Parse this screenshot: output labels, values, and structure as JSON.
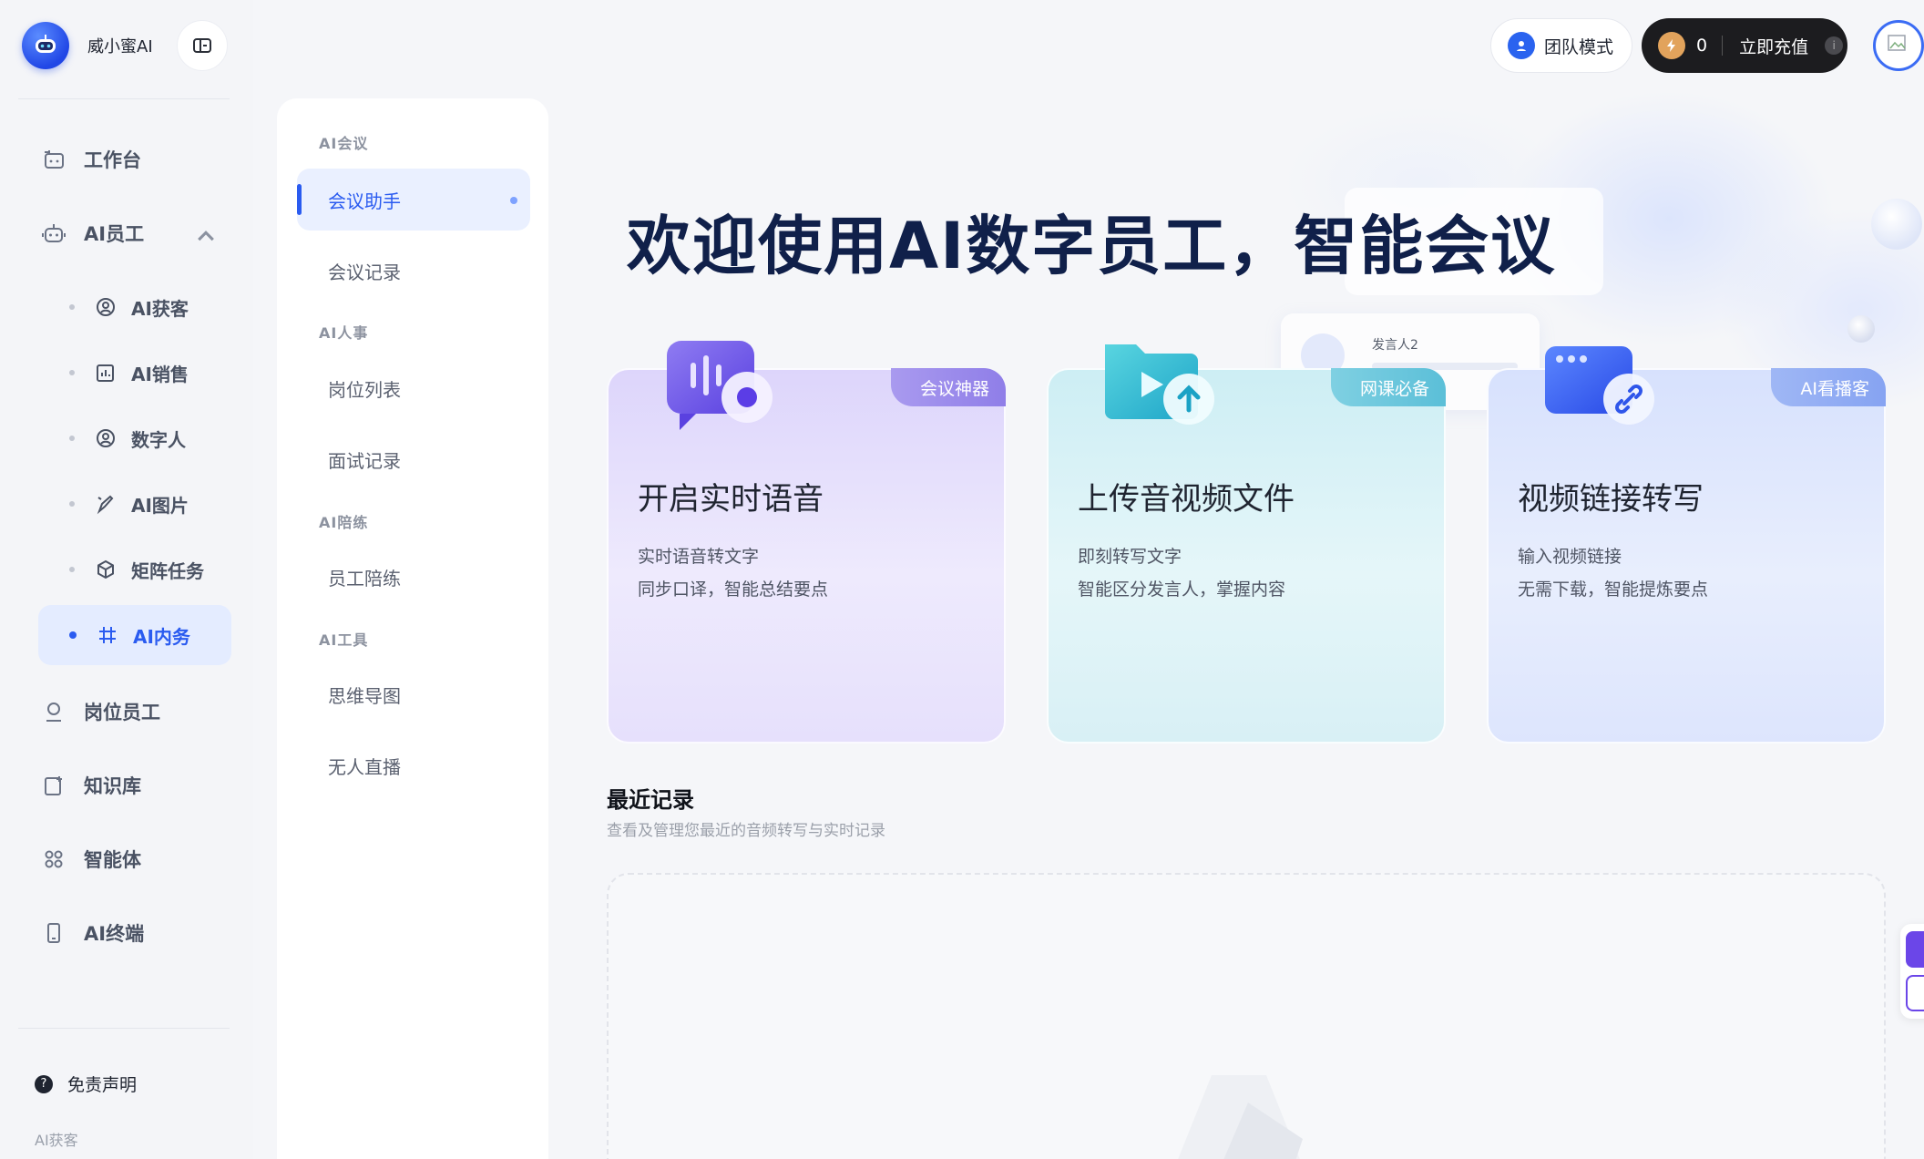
{
  "brand": {
    "name": "威小蜜AI"
  },
  "sidebar": {
    "top_items": [
      {
        "label": "工作台",
        "icon": "workbench-icon"
      },
      {
        "label": "AI员工",
        "icon": "robot-icon"
      }
    ],
    "sub_items": [
      {
        "label": "AI获客",
        "icon": "user-circle-icon"
      },
      {
        "label": "AI销售",
        "icon": "chart-icon"
      },
      {
        "label": "数字人",
        "icon": "user-circle-icon"
      },
      {
        "label": "AI图片",
        "icon": "brush-icon"
      },
      {
        "label": "矩阵任务",
        "icon": "cube-icon"
      },
      {
        "label": "AI内务",
        "icon": "hash-icon",
        "active": true
      }
    ],
    "bottom_items": [
      {
        "label": "岗位员工",
        "icon": "person-icon"
      },
      {
        "label": "知识库",
        "icon": "book-icon"
      },
      {
        "label": "智能体",
        "icon": "apps-icon"
      },
      {
        "label": "AI终端",
        "icon": "phone-icon"
      }
    ],
    "disclaimer": "免责声明",
    "footer_text": "AI获客"
  },
  "submenu": {
    "groups": [
      {
        "title": "AI会议",
        "items": [
          "会议助手",
          "会议记录"
        ]
      },
      {
        "title": "AI人事",
        "items": [
          "岗位列表",
          "面试记录"
        ]
      },
      {
        "title": "AI陪练",
        "items": [
          "员工陪练"
        ]
      },
      {
        "title": "AI工具",
        "items": [
          "思维导图",
          "无人直播"
        ]
      }
    ],
    "active_item": "会议助手"
  },
  "topbar": {
    "team_mode_label": "团队模式",
    "balance": "0",
    "recharge_label": "立即充值",
    "info_glyph": "i"
  },
  "hero": {
    "title": "欢迎使用AI数字员工，智能会议",
    "deco_speaker": "发言人2"
  },
  "cards": [
    {
      "tag": "会议神器",
      "title": "开启实时语音",
      "line1": "实时语音转文字",
      "line2": "同步口译，智能总结要点",
      "icon": "voice-icon"
    },
    {
      "tag": "网课必备",
      "title": "上传音视频文件",
      "line1": "即刻转写文字",
      "line2": "智能区分发言人，掌握内容",
      "icon": "upload-video-icon"
    },
    {
      "tag": "AI看播客",
      "title": "视频链接转写",
      "line1": "输入视频链接",
      "line2": "无需下载，智能提炼要点",
      "icon": "link-icon"
    }
  ],
  "recent": {
    "title": "最近记录",
    "subtitle": "查看及管理您最近的音频转写与实时记录"
  },
  "colors": {
    "accent": "#2a5bf0",
    "hero_title": "#10204a",
    "recharge_bg": "#1c1c1f"
  }
}
